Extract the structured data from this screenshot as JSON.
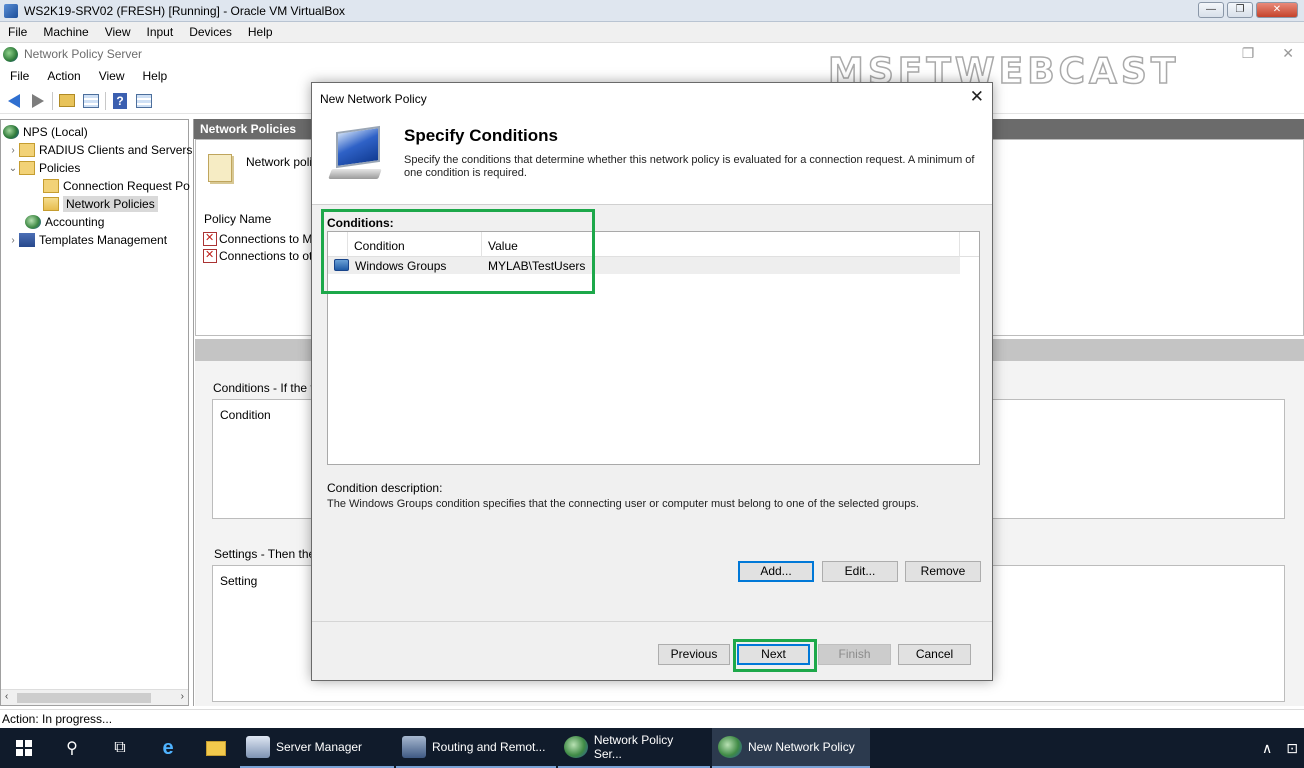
{
  "vbox": {
    "title": "WS2K19-SRV02 (FRESH) [Running] - Oracle VM VirtualBox",
    "menu": [
      "File",
      "Machine",
      "View",
      "Input",
      "Devices",
      "Help"
    ],
    "ctrl_min": "—",
    "ctrl_max": "❐",
    "ctrl_close": "✕"
  },
  "mmc": {
    "title": "Network Policy Server",
    "watermark": "MSFTWEBCAST",
    "menu": [
      "File",
      "Action",
      "View",
      "Help"
    ],
    "win_restore": "❐",
    "win_close": "✕"
  },
  "tree": {
    "items": [
      {
        "label": "NPS (Local)",
        "icon": "globe-icon"
      },
      {
        "label": "RADIUS Clients and Servers",
        "icon": "folder-icon"
      },
      {
        "label": "Policies",
        "icon": "folder-icon"
      },
      {
        "label": "Connection Request Po",
        "icon": "folder-icon"
      },
      {
        "label": "Network Policies",
        "icon": "folder-open-icon"
      },
      {
        "label": "Accounting",
        "icon": "accounting-icon"
      },
      {
        "label": "Templates Management",
        "icon": "templates-icon"
      }
    ]
  },
  "pane": {
    "header": "Network Policies",
    "note": "Network polici",
    "col_policy_name": "Policy Name",
    "rows": [
      "Connections to Micr",
      "Connections to othe"
    ],
    "conditions_label": "Conditions - If the follo",
    "condition_col": "Condition",
    "settings_label": "Settings - Then the fo",
    "setting_col": "Setting"
  },
  "status": {
    "text": "Action:  In progress..."
  },
  "dialog": {
    "title": "New Network Policy",
    "close": "✕",
    "heading": "Specify Conditions",
    "description": "Specify the conditions that determine whether this network policy is evaluated for a connection request. A minimum of one condition is required.",
    "conditions_label": "Conditions:",
    "columns": [
      "Condition",
      "Value"
    ],
    "rows": [
      {
        "condition": "Windows Groups",
        "value": "MYLAB\\TestUsers"
      }
    ],
    "desc_title": "Condition description:",
    "desc_text": "The Windows Groups condition specifies that the connecting user or computer must belong to one of the selected groups.",
    "buttons": {
      "add": "Add...",
      "edit": "Edit...",
      "remove": "Remove",
      "previous": "Previous",
      "next": "Next",
      "finish": "Finish",
      "cancel": "Cancel"
    }
  },
  "taskbar": {
    "apps": [
      {
        "label": "Server Manager"
      },
      {
        "label": "Routing and Remot..."
      },
      {
        "label": "Network Policy Ser..."
      },
      {
        "label": "New Network Policy"
      }
    ],
    "tray": {
      "chevron": "∧",
      "network": "⊡"
    }
  },
  "colors": {
    "highlight": "#1da84a",
    "taskbar": "#101b2b",
    "pane_header": "#6b6b6b"
  }
}
